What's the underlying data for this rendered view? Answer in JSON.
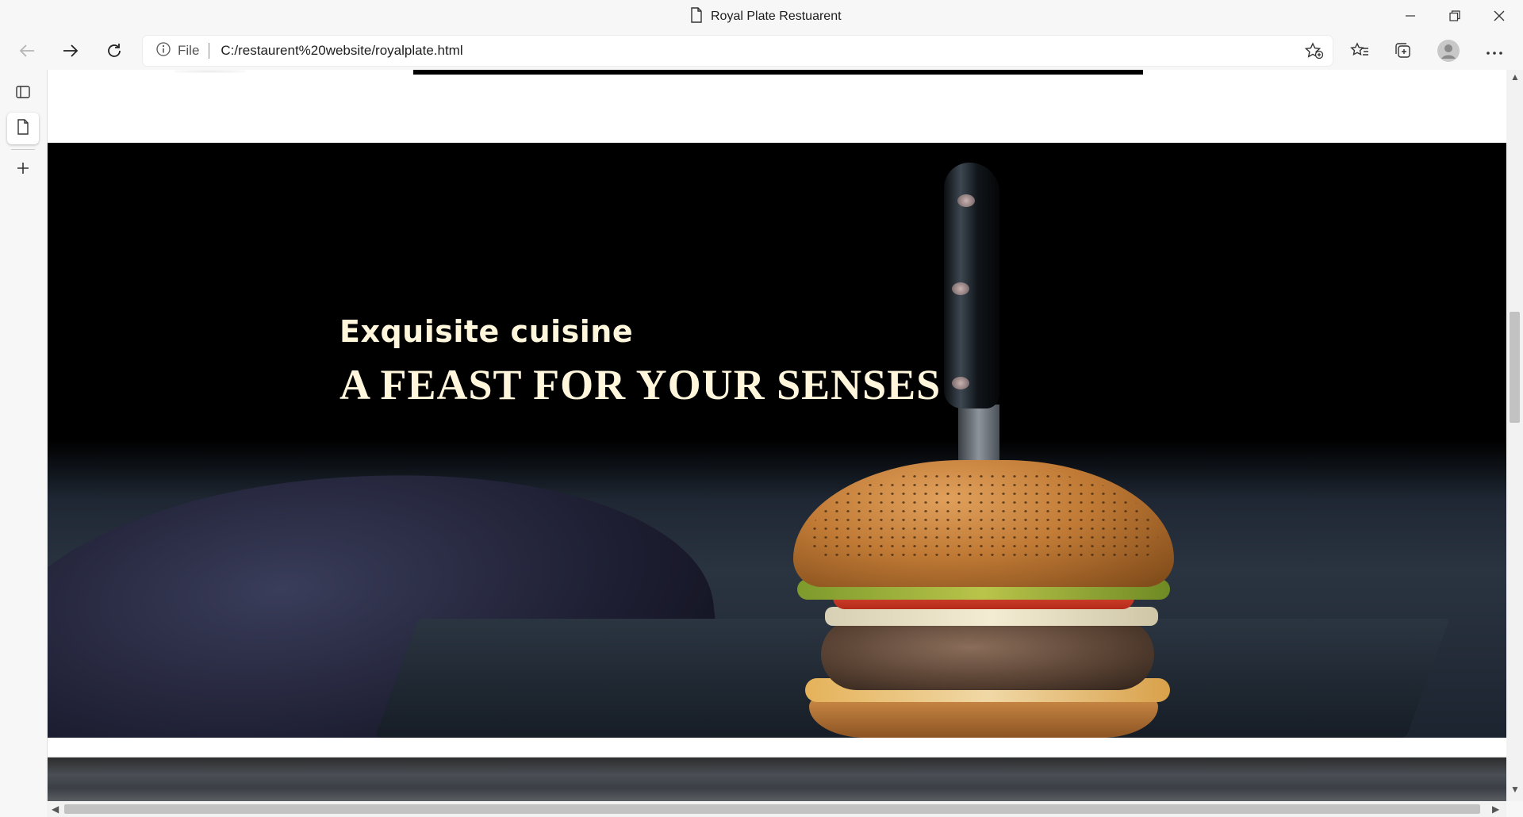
{
  "window": {
    "title": "Royal Plate Restuarent",
    "controls": [
      "minimize",
      "restore",
      "close"
    ]
  },
  "toolbar": {
    "back_icon": "arrow-left-icon",
    "forward_icon": "arrow-right-icon",
    "refresh_icon": "refresh-icon",
    "address": {
      "scheme_label": "File",
      "url": "C:/restaurent%20website/royalplate.html"
    },
    "right_icons": [
      "add-favorite-icon",
      "favorites-icon",
      "collections-icon",
      "profile-avatar",
      "more-icon"
    ]
  },
  "sidetabs": {
    "items": [
      "tab-actions-icon",
      "page-tab-icon",
      "new-tab-icon"
    ]
  },
  "hero": {
    "subtitle": "Exquisite cuisine",
    "title": "A FEAST FOR YOUR SENSES",
    "text_color": "#fff6dc"
  }
}
